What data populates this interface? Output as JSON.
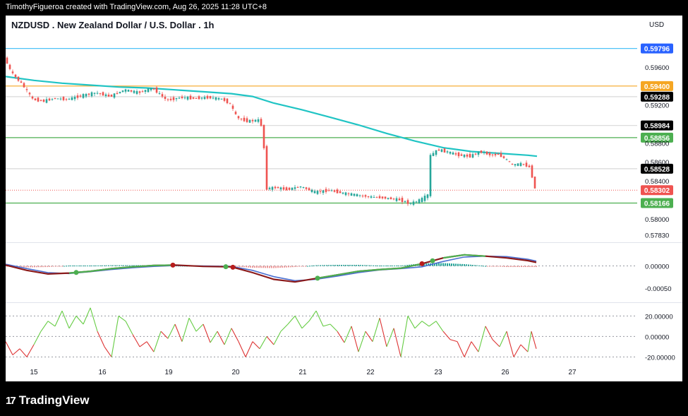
{
  "header": {
    "credit": "TimothyFigueroa created with TradingView.com, Aug 26, 2025 11:28 UTC+8"
  },
  "footer": {
    "brand": "TradingView",
    "logo_icon": "tradingview-logo-icon"
  },
  "colors": {
    "up": "#26a69a",
    "down": "#ef5350",
    "ma": "#20c4c4",
    "macd_fast": "#8b1a1a",
    "macd_slow": "#4a6fd1",
    "macd_alt": "#4caf50",
    "osc_up": "#66cc44",
    "osc_down": "#dd3333"
  },
  "chart_data": [
    {
      "type": "line",
      "panel": "price",
      "title": "NZDUSD . New Zealand Dollar / U.S. Dollar . 1h",
      "currency": "USD",
      "x_ticks": [
        "15",
        "16",
        "19",
        "20",
        "21",
        "22",
        "23",
        "26",
        "27"
      ],
      "y_ticks": [
        "0.59600",
        "0.59200",
        "0.58800",
        "0.58600",
        "0.58400",
        "0.58000",
        "0.57830"
      ],
      "ylim": [
        0.5776,
        0.5992
      ],
      "horizontal_levels": [
        {
          "value": 0.59796,
          "label": "0.59796",
          "color": "#4fc3f7",
          "label_bg": "#2962ff"
        },
        {
          "value": 0.594,
          "label": "0.59400",
          "color": "#f5a623",
          "label_bg": "#f5a623"
        },
        {
          "value": 0.59288,
          "label": "0.59288",
          "color": "#d8d8d8",
          "label_bg": "#000000"
        },
        {
          "value": 0.58984,
          "label": "0.58984",
          "color": "#d8d8d8",
          "label_bg": "#000000"
        },
        {
          "value": 0.58856,
          "label": "0.58856",
          "color": "#4caf50",
          "label_bg": "#4caf50"
        },
        {
          "value": 0.58528,
          "label": "0.58528",
          "color": "#d8d8d8",
          "label_bg": "#000000"
        },
        {
          "value": 0.58302,
          "label": "0.58302",
          "color": "#ef5350",
          "label_bg": "#ef5350",
          "dotted": true
        },
        {
          "value": 0.58166,
          "label": "0.58166",
          "color": "#4caf50",
          "label_bg": "#4caf50"
        }
      ],
      "moving_average": {
        "x": [
          0,
          40,
          80,
          120,
          160,
          200,
          240,
          280,
          320,
          350,
          380,
          420,
          460,
          500,
          540,
          580,
          620,
          660,
          700,
          740,
          753
        ],
        "y": [
          0.595,
          0.5946,
          0.5943,
          0.5941,
          0.5939,
          0.5938,
          0.5936,
          0.5934,
          0.5932,
          0.5929,
          0.5922,
          0.5915,
          0.5907,
          0.5899,
          0.589,
          0.5882,
          0.5875,
          0.5871,
          0.5869,
          0.5867,
          0.5866
        ]
      },
      "price_path": {
        "x": [
          0,
          10,
          25,
          40,
          55,
          70,
          90,
          110,
          130,
          150,
          170,
          190,
          210,
          230,
          250,
          270,
          290,
          310,
          320,
          330,
          345,
          360,
          366,
          372,
          385,
          400,
          420,
          440,
          460,
          480,
          500,
          520,
          540,
          560,
          575,
          590,
          600,
          603,
          606,
          615,
          630,
          645,
          660,
          675,
          690,
          700,
          710,
          720,
          735,
          745,
          752
        ],
        "y": [
          0.597,
          0.5954,
          0.5942,
          0.5926,
          0.5924,
          0.5927,
          0.5926,
          0.593,
          0.5933,
          0.5929,
          0.5936,
          0.5933,
          0.5938,
          0.5925,
          0.5928,
          0.5927,
          0.5928,
          0.5926,
          0.5921,
          0.5906,
          0.5903,
          0.5904,
          0.5896,
          0.5832,
          0.5833,
          0.5831,
          0.5834,
          0.5828,
          0.583,
          0.5827,
          0.5825,
          0.5823,
          0.5822,
          0.582,
          0.5816,
          0.582,
          0.5825,
          0.5866,
          0.5868,
          0.5873,
          0.587,
          0.5867,
          0.5866,
          0.5871,
          0.5867,
          0.5868,
          0.5863,
          0.5857,
          0.5858,
          0.5854,
          0.5832
        ]
      }
    },
    {
      "type": "line",
      "panel": "macd",
      "y_ticks": [
        "0.00000",
        "-0.00050"
      ],
      "ylim": [
        -0.0008,
        0.0005
      ],
      "series": [
        {
          "x": [
            0,
            30,
            60,
            90,
            120,
            150,
            180,
            210,
            240,
            280,
            320,
            350,
            380,
            410,
            440,
            470,
            500,
            530,
            560,
            590,
            620,
            650,
            680,
            710,
            740,
            752
          ],
          "y": [
            2e-05,
            -0.0001,
            -0.00018,
            -0.00016,
            -0.00012,
            -6e-05,
            -2e-05,
            1e-05,
            2e-05,
            -1e-05,
            -2e-05,
            -0.00015,
            -0.0003,
            -0.00036,
            -0.00028,
            -0.0002,
            -0.00012,
            -8e-05,
            -5e-05,
            5e-05,
            0.00018,
            0.00025,
            0.00022,
            0.00018,
            0.00012,
            8e-05
          ]
        },
        {
          "x": [
            0,
            30,
            60,
            90,
            120,
            150,
            180,
            210,
            240,
            280,
            320,
            350,
            380,
            410,
            440,
            470,
            500,
            530,
            560,
            590,
            620,
            650,
            680,
            710,
            740,
            752
          ],
          "y": [
            4e-05,
            -6e-05,
            -0.00015,
            -0.00017,
            -0.00013,
            -8e-05,
            -4e-05,
            -1e-05,
            1e-05,
            0.0,
            -1e-05,
            -0.0001,
            -0.00024,
            -0.00033,
            -0.0003,
            -0.00023,
            -0.00015,
            -9e-05,
            -6e-05,
            -2e-05,
            0.0001,
            0.0002,
            0.00022,
            0.00021,
            0.00015,
            0.00011
          ]
        }
      ]
    },
    {
      "type": "line",
      "panel": "oscillator",
      "y_ticks": [
        "20.00000",
        "0.00000",
        "-20.00000"
      ],
      "ylim": [
        -28,
        32
      ],
      "series": [
        {
          "x": [
            0,
            10,
            20,
            30,
            40,
            50,
            60,
            70,
            80,
            90,
            100,
            110,
            120,
            130,
            140,
            150,
            160,
            170,
            180,
            190,
            200,
            210,
            220,
            230,
            240,
            250,
            260,
            270,
            280,
            290,
            300,
            310,
            320,
            330,
            340,
            350,
            360,
            370,
            380,
            390,
            400,
            410,
            420,
            430,
            440,
            450,
            460,
            470,
            480,
            490,
            500,
            510,
            520,
            530,
            540,
            550,
            560,
            570,
            580,
            590,
            600,
            610,
            620,
            630,
            640,
            650,
            660,
            670,
            680,
            690,
            700,
            710,
            720,
            730,
            740,
            745,
            752
          ],
          "y": [
            -5,
            -18,
            -12,
            -20,
            -8,
            5,
            15,
            10,
            25,
            8,
            20,
            12,
            28,
            5,
            -10,
            -20,
            20,
            15,
            2,
            -10,
            -5,
            -15,
            5,
            -2,
            12,
            -5,
            18,
            5,
            12,
            -6,
            5,
            -8,
            8,
            -5,
            -20,
            -5,
            -12,
            0,
            -8,
            5,
            12,
            20,
            8,
            15,
            25,
            10,
            12,
            5,
            -6,
            10,
            -15,
            5,
            -5,
            18,
            -10,
            8,
            -20,
            20,
            8,
            15,
            10,
            15,
            5,
            -3,
            -5,
            -20,
            -5,
            -15,
            10,
            -3,
            -10,
            5,
            -20,
            -8,
            -15,
            5,
            -12
          ]
        }
      ]
    }
  ]
}
